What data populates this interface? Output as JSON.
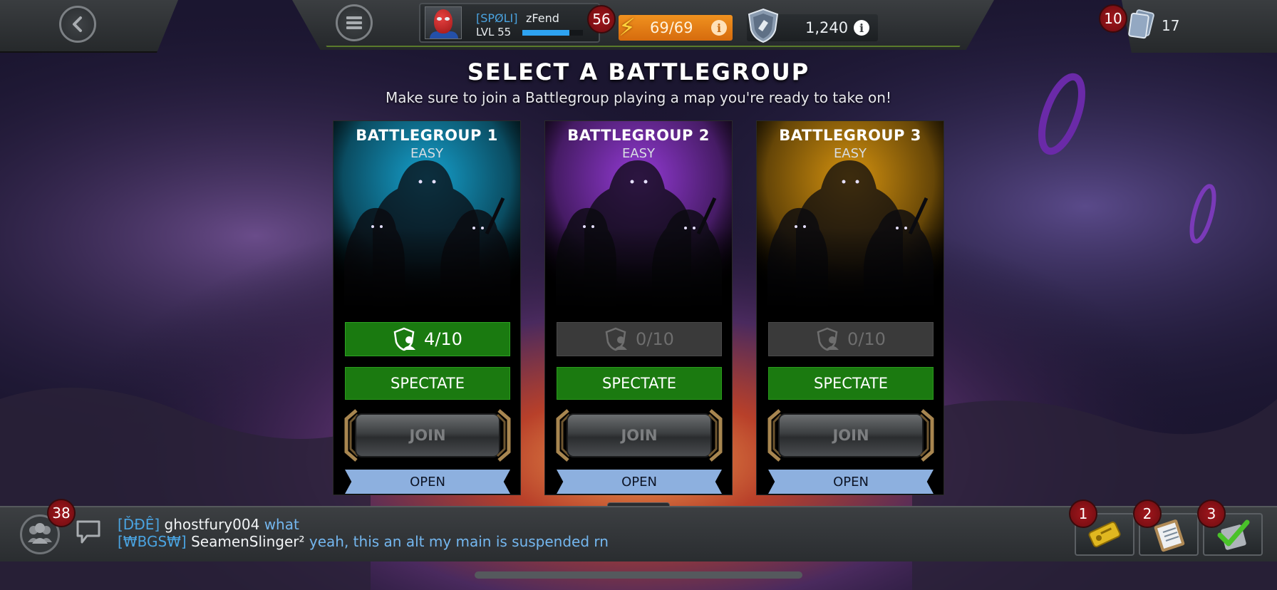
{
  "header": {
    "alliance_tag": "[SPØLI]",
    "player_name": "zFend",
    "player_level": "LVL 55",
    "xp_fraction": 0.78,
    "level_badge": "56",
    "energy": "69/69",
    "shield_currency": "1,240",
    "items_badge": "10",
    "items_count": "17",
    "icons": [
      "chevron-left-icon",
      "menu-icon",
      "lightning-icon",
      "info-icon",
      "shield-icon",
      "item-stack-icon"
    ]
  },
  "page": {
    "title": "SELECT A BATTLEGROUP",
    "subtitle": "Make sure to join a Battlegroup playing a map you're ready to take on!"
  },
  "battlegroups": [
    {
      "title": "BATTLEGROUP 1",
      "difficulty": "EASY",
      "slots": "4/10",
      "spectate_label": "SPECTATE",
      "join_label": "JOIN",
      "status": "OPEN",
      "glow_color": "#17a9d8",
      "slots_active": true
    },
    {
      "title": "BATTLEGROUP 2",
      "difficulty": "EASY",
      "slots": "0/10",
      "spectate_label": "SPECTATE",
      "join_label": "JOIN",
      "status": "OPEN",
      "glow_color": "#9b3de0",
      "slots_active": false
    },
    {
      "title": "BATTLEGROUP 3",
      "difficulty": "EASY",
      "slots": "0/10",
      "spectate_label": "SPECTATE",
      "join_label": "JOIN",
      "status": "OPEN",
      "glow_color": "#e09a10",
      "slots_active": false
    }
  ],
  "pager": {
    "active_page": 1,
    "page_count": 2
  },
  "chat": {
    "friends_badge": "38",
    "messages": [
      {
        "tag": "[ĎĐÊ]",
        "user": "ghostfury004",
        "text": "what"
      },
      {
        "tag": "[₩BGS₩]",
        "user": "SeamenSlinger²",
        "text": "yeah, this an alt my main is suspended rn"
      }
    ]
  },
  "actions": [
    {
      "badge": "1",
      "icon": "ticket-icon"
    },
    {
      "badge": "2",
      "icon": "clipboard-icon"
    },
    {
      "badge": "3",
      "icon": "checkmark-icon"
    }
  ],
  "colors": {
    "accent_green": "#1b7a10",
    "open_ribbon": "#8db0df",
    "badge_red": "#a0161c",
    "energy_orange": "#e57e15"
  }
}
